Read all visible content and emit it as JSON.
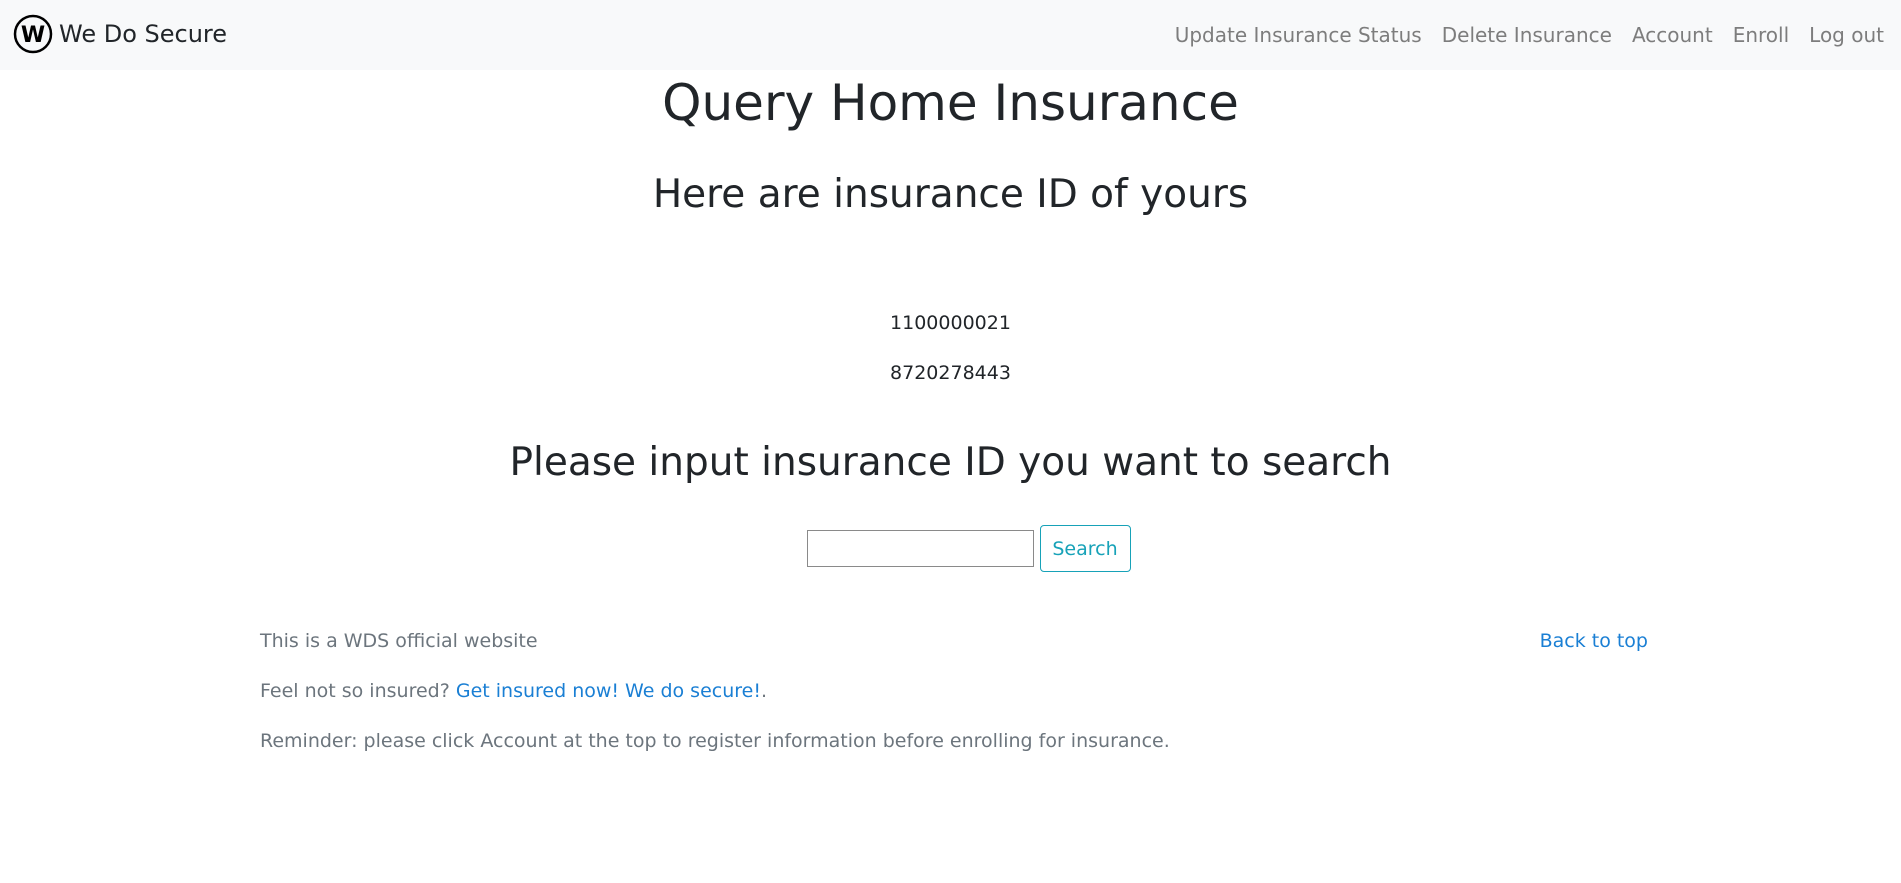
{
  "brand": {
    "name": "We Do Secure",
    "logo_letter": "W",
    "logo_icon": "circle-w-logo"
  },
  "nav": {
    "items": [
      {
        "label": "Update Insurance Status"
      },
      {
        "label": "Delete Insurance"
      },
      {
        "label": "Account"
      },
      {
        "label": "Enroll"
      },
      {
        "label": "Log out"
      }
    ]
  },
  "main": {
    "title": "Query Home Insurance",
    "ids_heading": "Here are insurance ID of yours",
    "insurance_ids": [
      "1100000021",
      "8720278443"
    ],
    "search_heading": "Please input insurance ID you want to search",
    "search": {
      "value": "",
      "placeholder": "",
      "button_label": "Search"
    }
  },
  "footer": {
    "official_text": "This is a WDS official website",
    "back_to_top": "Back to top",
    "promo_prefix": "Feel not so insured? ",
    "promo_link": "Get insured now! We do secure!",
    "promo_suffix": ".",
    "reminder": "Reminder: please click Account at the top to register information before enrolling for insurance."
  },
  "colors": {
    "navbar_bg": "#f8f9fa",
    "nav_link": "#7d7d7d",
    "heading": "#212529",
    "footer_text": "#6c757d",
    "link": "#1a7fd4",
    "search_button": "#17a2b8"
  }
}
